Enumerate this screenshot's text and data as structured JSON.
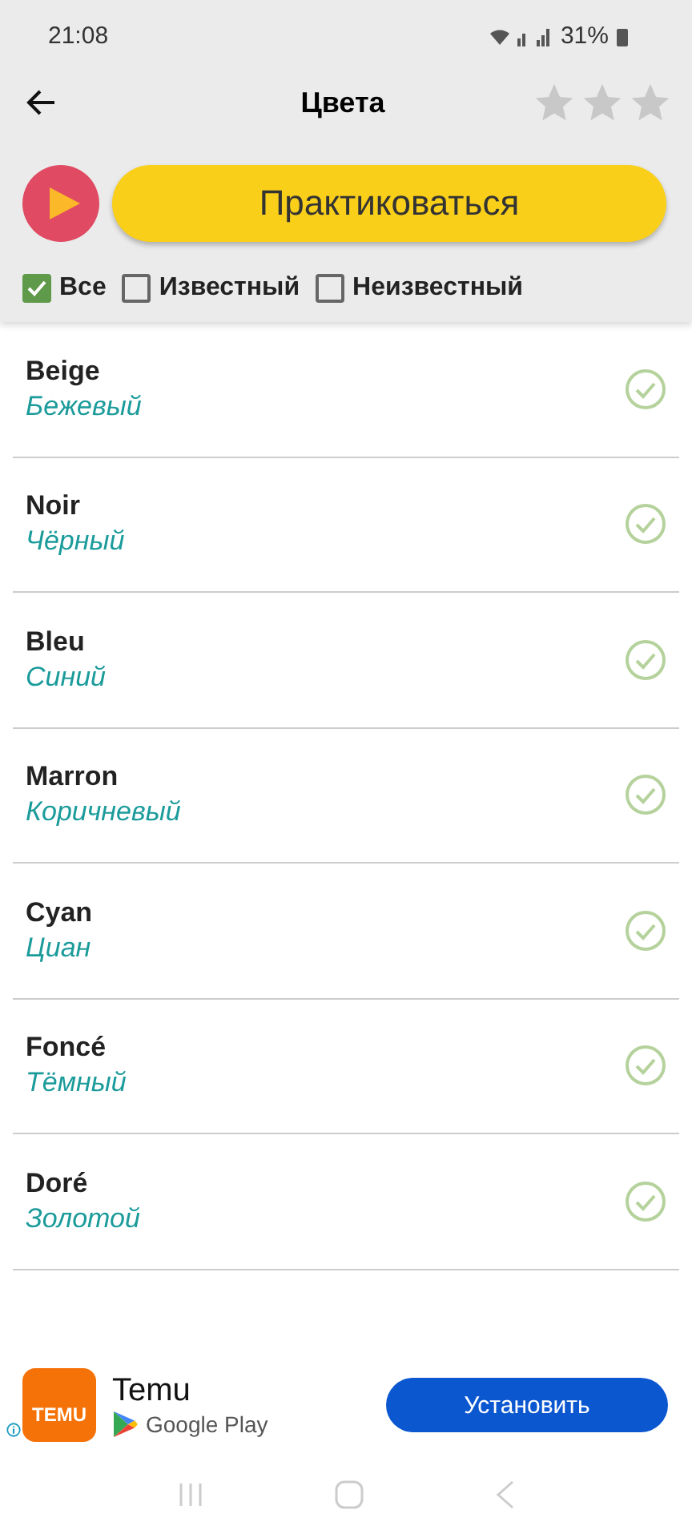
{
  "status_bar": {
    "time": "21:08",
    "battery": "31%"
  },
  "toolbar": {
    "title": "Цвета",
    "stars": 0
  },
  "practice_button": {
    "label": "Практиковаться"
  },
  "filters": [
    {
      "label": "Все",
      "checked": true
    },
    {
      "label": "Известный",
      "checked": false
    },
    {
      "label": "Неизвестный",
      "checked": false
    }
  ],
  "words": [
    {
      "word": "Beige",
      "translation": "Бежевый",
      "learned": true
    },
    {
      "word": "Noir",
      "translation": "Чёрный",
      "learned": true
    },
    {
      "word": "Bleu",
      "translation": "Синий",
      "learned": true
    },
    {
      "word": "Marron",
      "translation": "Коричневый",
      "learned": true
    },
    {
      "word": "Cyan",
      "translation": "Циан",
      "learned": true
    },
    {
      "word": "Foncé",
      "translation": "Тёмный",
      "learned": true
    },
    {
      "word": "Doré",
      "translation": "Золотой",
      "learned": true
    }
  ],
  "ad": {
    "logo_text": "TEMU",
    "app_name": "Temu",
    "store": "Google Play",
    "button": "Установить"
  }
}
